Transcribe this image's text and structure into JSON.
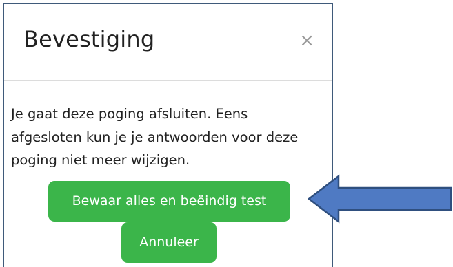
{
  "dialog": {
    "title": "Bevestiging",
    "close_label": "×",
    "body_text": "Je gaat deze poging afsluiten. Eens afgesloten kun je je antwoorden voor deze poging niet meer wijzigen.",
    "submit_label": "Bewaar alles en beëindig test",
    "cancel_label": "Annuleer"
  },
  "annotation": {
    "arrow_direction": "left",
    "arrow_fill": "#4f7ac3",
    "arrow_stroke": "#2f4f7f"
  },
  "colors": {
    "button_green": "#3bb54a",
    "modal_border": "#3f5a7a"
  }
}
